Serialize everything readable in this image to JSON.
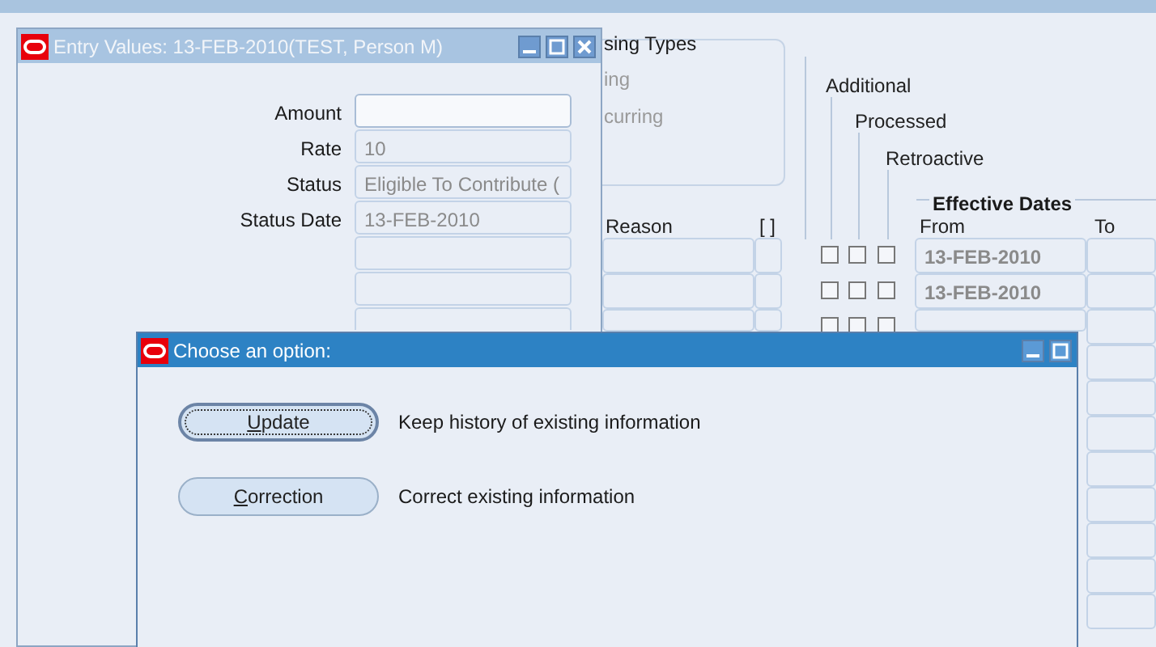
{
  "background_form": {
    "group_title": "sing Types",
    "group_options": [
      "ing",
      "curring"
    ],
    "column_headers": [
      "Additional",
      "Processed",
      "Retroactive"
    ],
    "effective_dates": {
      "title": "Effective Dates",
      "from": "From",
      "to": "To"
    },
    "reason_header": "Reason",
    "flag_header": "[ ]",
    "rows": [
      {
        "checks": [
          false,
          false,
          false
        ],
        "from": "13-FEB-2010"
      },
      {
        "checks": [
          false,
          false,
          false
        ],
        "from": "13-FEB-2010"
      },
      {
        "checks": [
          false,
          false,
          false
        ]
      }
    ]
  },
  "entry_window": {
    "title": "Entry Values: 13-FEB-2010(TEST, Person M)",
    "fields": [
      {
        "label": "Amount",
        "disabled": false
      },
      {
        "label": "Rate",
        "value": "10",
        "disabled": true
      },
      {
        "label": "Status",
        "value": "Eligible To Contribute (",
        "disabled": true
      },
      {
        "label": "Status Date",
        "value": "13-FEB-2010",
        "disabled": true
      }
    ]
  },
  "dialog": {
    "title": "Choose an option:",
    "options": [
      {
        "button": "Update",
        "focused": true,
        "description": "Keep history of existing information"
      },
      {
        "button": "Correction",
        "focused": false,
        "description": "Correct existing information"
      }
    ]
  }
}
